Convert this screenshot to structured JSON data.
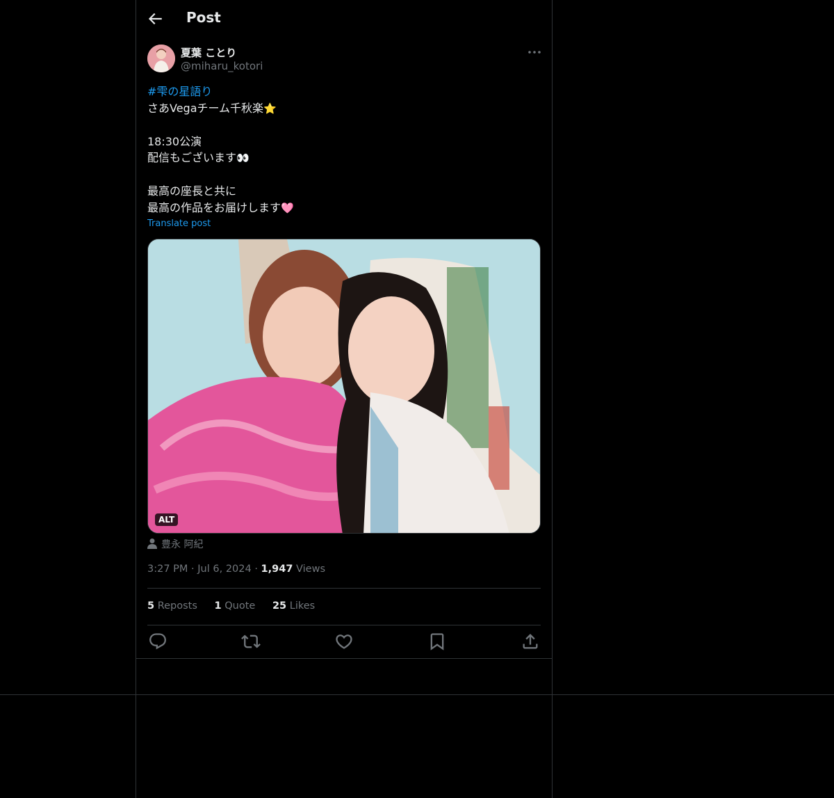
{
  "header": {
    "title": "Post",
    "back_icon": "arrow-left-icon"
  },
  "author": {
    "name": "夏葉 ことり",
    "handle": "@miharu_kotori",
    "more_icon": "more-horizontal-icon"
  },
  "tweet": {
    "hashtag": "#雫の星語り",
    "line2": "さあVegaチーム千秋楽",
    "emoji_star": "⭐",
    "line4": "18:30公演",
    "line5": "配信もございます",
    "emoji_eyes": "👀",
    "line7": "最高の座長と共に",
    "line8": "最高の作品をお届けします",
    "emoji_heart": "🩷"
  },
  "translate_label": "Translate post",
  "media": {
    "alt_badge": "ALT"
  },
  "tagged_user": "豊永 阿紀",
  "meta": {
    "time": "3:27 PM",
    "sep1": "·",
    "date": "Jul 6, 2024",
    "sep2": "·",
    "views_count": "1,947",
    "views_label": "Views"
  },
  "stats": {
    "reposts_count": "5",
    "reposts_label": "Reposts",
    "quotes_count": "1",
    "quotes_label": "Quote",
    "likes_count": "25",
    "likes_label": "Likes"
  },
  "actions": [
    "reply-icon",
    "repost-icon",
    "like-icon",
    "bookmark-icon",
    "share-icon"
  ],
  "colors": {
    "background": "#000000",
    "text": "#e7e9ea",
    "secondary": "#71767b",
    "accent": "#1d9bf0",
    "border": "#2f3336"
  }
}
